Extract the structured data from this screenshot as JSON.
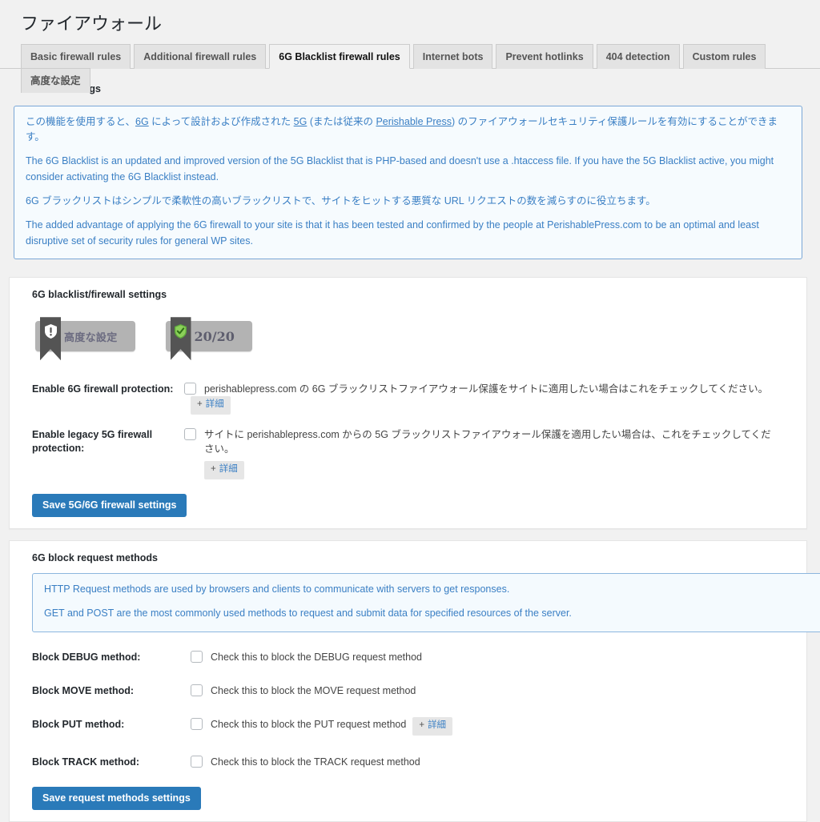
{
  "page": {
    "title": "ファイアウォール",
    "section_label": "Firewall settings"
  },
  "tabs": [
    {
      "label": "Basic firewall rules",
      "active": false
    },
    {
      "label": "Additional firewall rules",
      "active": false
    },
    {
      "label": "6G Blacklist firewall rules",
      "active": true
    },
    {
      "label": "Internet bots",
      "active": false
    },
    {
      "label": "Prevent hotlinks",
      "active": false
    },
    {
      "label": "404 detection",
      "active": false
    },
    {
      "label": "Custom rules",
      "active": false
    },
    {
      "label": "高度な設定",
      "active": false
    }
  ],
  "intro": {
    "p1_before": "この機能を使用すると、",
    "p1_link1": "6G",
    "p1_mid1": " によって設計および作成された ",
    "p1_link2": "5G",
    "p1_mid2": " (または従来の ",
    "p1_link3": "Perishable Press",
    "p1_after": ") のファイアウォールセキュリティ保護ルールを有効にすることができます。",
    "p2": "The 6G Blacklist is an updated and improved version of the 5G Blacklist that is PHP-based and doesn't use a .htaccess file. If you have the 5G Blacklist active, you might consider activating the 6G Blacklist instead.",
    "p3": "6G ブラックリストはシンプルで柔軟性の高いブラックリストで、サイトをヒットする悪質な URL リクエストの数を減らすのに役立ちます。",
    "p4": "The added advantage of applying the 6G firewall to your site is that it has been tested and confirmed by the people at PerishablePress.com to be an optimal and least disruptive set of security rules for general WP sites."
  },
  "blacklist_settings": {
    "title": "6G blacklist/firewall settings",
    "ribbons": [
      {
        "icon": "shield-exclamation-icon",
        "text": "高度な設定",
        "variant": "advanced"
      },
      {
        "icon": "shield-check-icon",
        "text": "20/20",
        "variant": "score"
      }
    ],
    "rows": [
      {
        "label": "Enable 6G firewall protection:",
        "checkbox_text": "perishablepress.com の 6G ブラックリストファイアウォール保護をサイトに適用したい場合はこれをチェックしてください。",
        "checked": false,
        "more_label": "詳細",
        "more_plus": "+",
        "more_inline": true
      },
      {
        "label": "Enable legacy 5G firewall protection:",
        "checkbox_text": "サイトに perishablepress.com からの 5G ブラックリストファイアウォール保護を適用したい場合は、これをチェックしてください。",
        "checked": false,
        "more_label": "詳細",
        "more_plus": "+",
        "more_inline": false
      }
    ],
    "save_label": "Save 5G/6G firewall settings"
  },
  "request_methods": {
    "title": "6G block request methods",
    "info_p1": "HTTP Request methods are used by browsers and clients to communicate with servers to get responses.",
    "info_p2": "GET and POST are the most commonly used methods to request and submit data for specified resources of the server.",
    "rows": [
      {
        "label": "Block DEBUG method:",
        "checkbox_text": "Check this to block the DEBUG request method",
        "checked": false,
        "has_more": false,
        "more_label": "",
        "more_plus": ""
      },
      {
        "label": "Block MOVE method:",
        "checkbox_text": "Check this to block the MOVE request method",
        "checked": false,
        "has_more": false,
        "more_label": "",
        "more_plus": ""
      },
      {
        "label": "Block PUT method:",
        "checkbox_text": "Check this to block the PUT request method",
        "checked": false,
        "has_more": true,
        "more_label": "詳細",
        "more_plus": "+"
      },
      {
        "label": "Block TRACK method:",
        "checkbox_text": "Check this to block the TRACK request method",
        "checked": false,
        "has_more": false,
        "more_label": "",
        "more_plus": ""
      }
    ],
    "save_label": "Save request methods settings"
  },
  "colors": {
    "accent_blue": "#2a7ab9",
    "notice_border": "#7aa7d6",
    "notice_bg": "#f6fbfe",
    "page_bg": "#f1f1f1",
    "ribbon_bg": "#b3b3b3",
    "ribbon_flag": "#545454",
    "shield_green": "#6ab04c"
  }
}
